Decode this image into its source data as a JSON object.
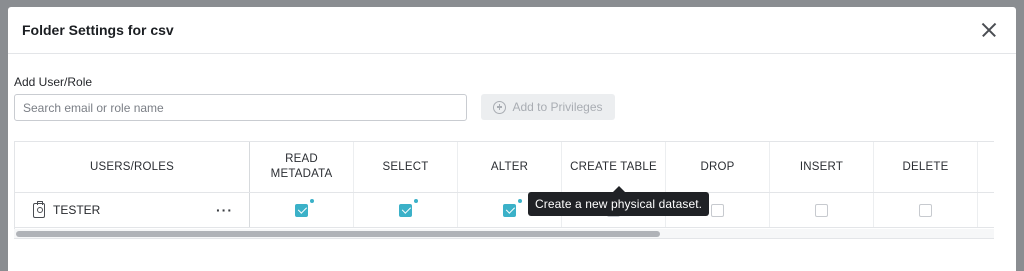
{
  "modal": {
    "title": "Folder Settings for csv"
  },
  "add_user": {
    "label": "Add User/Role",
    "placeholder": "Search email or role name",
    "value": "",
    "button_label": "Add to Privileges"
  },
  "grid": {
    "users_header": "USERS/ROLES",
    "columns": [
      "READ METADATA",
      "SELECT",
      "ALTER",
      "CREATE TABLE",
      "DROP",
      "INSERT",
      "DELETE"
    ],
    "rows": [
      {
        "name": "TESTER",
        "icon": "badge-icon",
        "permissions": [
          true,
          true,
          true,
          false,
          false,
          false,
          false
        ]
      }
    ]
  },
  "tooltip": {
    "text": "Create a new physical dataset."
  },
  "colors": {
    "accent": "#3bb1c8",
    "overlay": "#8a8d91"
  }
}
